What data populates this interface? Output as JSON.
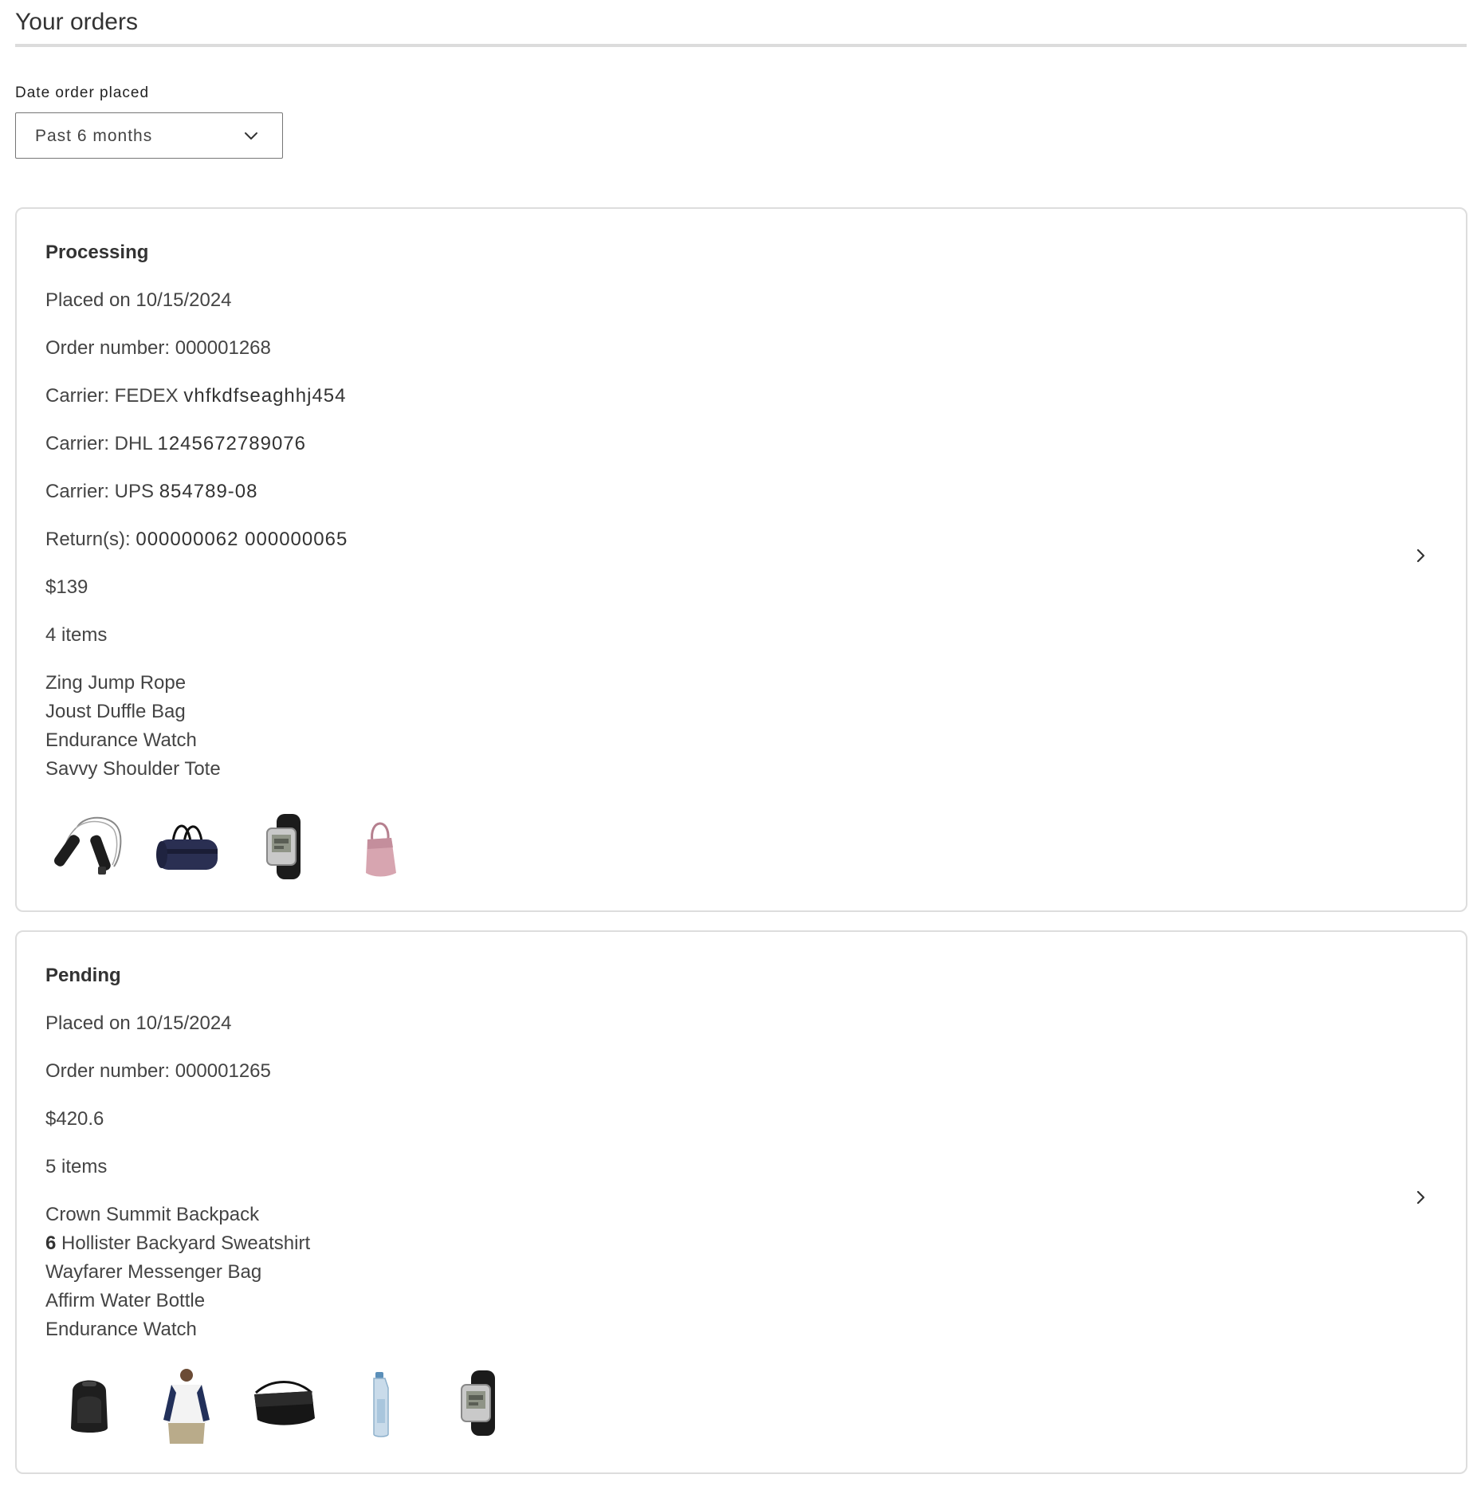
{
  "page": {
    "title": "Your orders"
  },
  "filter": {
    "label": "Date order placed",
    "selected": "Past 6 months",
    "icon": "chevron-down-icon"
  },
  "orders": [
    {
      "status": "Processing",
      "placed": "Placed on 10/15/2024",
      "order_number_label": "Order number:",
      "order_number": "000001268",
      "carriers": [
        {
          "label": "Carrier: FEDEX",
          "tracking": "vhfkdfseaghhj454"
        },
        {
          "label": "Carrier: DHL",
          "tracking": "1245672789076"
        },
        {
          "label": "Carrier: UPS",
          "tracking": "854789-08"
        }
      ],
      "returns_label": "Return(s):",
      "returns": "000000062 000000065",
      "total": "$139",
      "items_count": "4 items",
      "items": [
        {
          "qty": "",
          "name": "Zing Jump Rope",
          "thumb": "jump-rope"
        },
        {
          "qty": "",
          "name": "Joust Duffle Bag",
          "thumb": "duffle-bag"
        },
        {
          "qty": "",
          "name": "Endurance Watch",
          "thumb": "watch"
        },
        {
          "qty": "",
          "name": "Savvy Shoulder Tote",
          "thumb": "shoulder-tote"
        }
      ],
      "icon": "chevron-right-icon"
    },
    {
      "status": "Pending",
      "placed": "Placed on 10/15/2024",
      "order_number_label": "Order number:",
      "order_number": "000001265",
      "total": "$420.6",
      "items_count": "5 items",
      "items": [
        {
          "qty": "",
          "name": "Crown Summit Backpack",
          "thumb": "backpack"
        },
        {
          "qty": "6",
          "name": "Hollister Backyard Sweatshirt",
          "thumb": "sweatshirt"
        },
        {
          "qty": "",
          "name": "Wayfarer Messenger Bag",
          "thumb": "messenger-bag"
        },
        {
          "qty": "",
          "name": "Affirm Water Bottle",
          "thumb": "water-bottle"
        },
        {
          "qty": "",
          "name": "Endurance Watch",
          "thumb": "watch"
        }
      ],
      "icon": "chevron-right-icon"
    }
  ]
}
